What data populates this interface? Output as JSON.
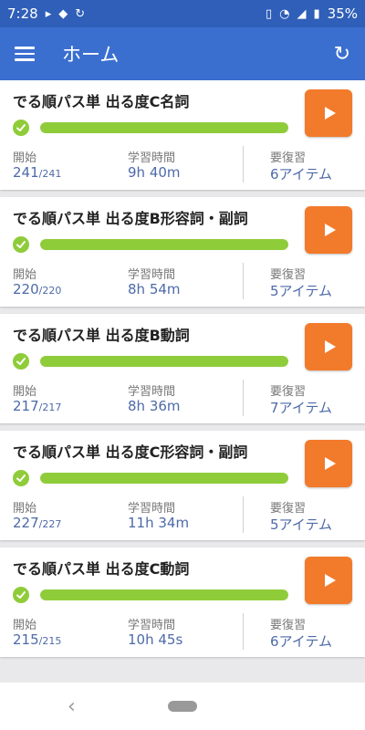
{
  "status_bar": {
    "time": "7:28",
    "battery": "35%"
  },
  "app_bar": {
    "title": "ホーム"
  },
  "labels": {
    "start": "開始",
    "study_time": "学習時間",
    "review_needed": "要復習"
  },
  "cards": [
    {
      "title": "でる順パス単 出る度C名詞",
      "progress": 1.0,
      "start_count": "241",
      "start_total": "/241",
      "study_time": "9h 40m",
      "review": "6アイテム"
    },
    {
      "title": "でる順パス単 出る度B形容詞・副詞",
      "progress": 1.0,
      "start_count": "220",
      "start_total": "/220",
      "study_time": "8h 54m",
      "review": "5アイテム"
    },
    {
      "title": "でる順パス単 出る度B動詞",
      "progress": 1.0,
      "start_count": "217",
      "start_total": "/217",
      "study_time": "8h 36m",
      "review": "7アイテム"
    },
    {
      "title": "でる順パス単 出る度C形容詞・副詞",
      "progress": 1.0,
      "start_count": "227",
      "start_total": "/227",
      "study_time": "11h 34m",
      "review": "5アイテム"
    },
    {
      "title": "でる順パス単 出る度C動詞",
      "progress": 1.0,
      "start_count": "215",
      "start_total": "/215",
      "study_time": "10h 45s",
      "review": "6アイテム"
    }
  ],
  "colors": {
    "status_bar": "#2f5fb8",
    "app_bar": "#3a6fd0",
    "progress": "#8fcc3a",
    "play_button": "#f27a2b",
    "value_text": "#4d6aa8"
  },
  "icons": {
    "menu": "menu-icon",
    "refresh": "refresh-icon",
    "play": "play-icon",
    "check": "check-circle-icon",
    "back": "back-icon",
    "home": "home-pill-icon"
  }
}
